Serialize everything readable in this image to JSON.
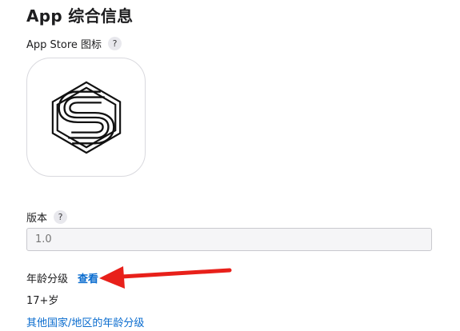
{
  "page": {
    "title": "App 综合信息"
  },
  "app_store_icon": {
    "label": "App Store 图标",
    "help_glyph": "?",
    "icon_name": "app-logo-s-icon"
  },
  "version": {
    "label": "版本",
    "help_glyph": "?",
    "placeholder": "1.0"
  },
  "age_rating": {
    "label": "年龄分级",
    "view_link": "查看",
    "value": "17+岁",
    "other_regions_link": "其他国家/地区的年龄分级"
  },
  "colors": {
    "link": "#0a6ccf",
    "annotation_arrow": "#e8201a"
  }
}
